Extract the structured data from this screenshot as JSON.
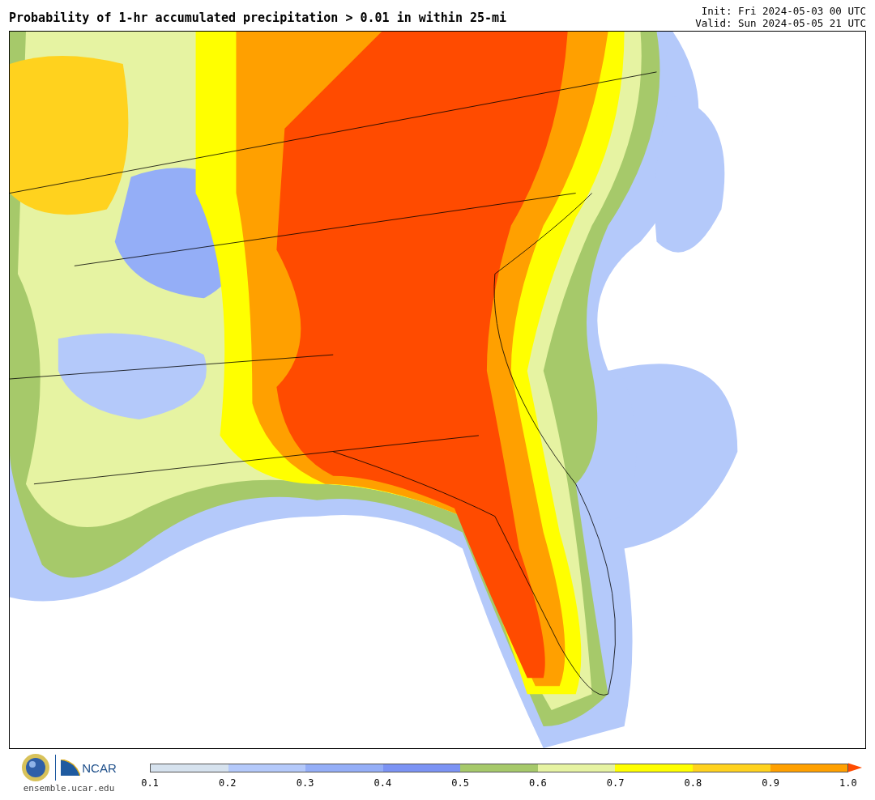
{
  "title": "Probability of 1-hr accumulated precipitation > 0.01 in within 25-mi",
  "init": "Init: Fri 2024-05-03 00 UTC",
  "valid": "Valid: Sun 2024-05-05 21 UTC",
  "footer": {
    "site": "ensemble.ucar.edu",
    "logo_text": "NCAR"
  },
  "colorbar": {
    "segments": [
      {
        "color": "#d6e2ee"
      },
      {
        "color": "#b4c9fa"
      },
      {
        "color": "#94aef7"
      },
      {
        "color": "#7b93f4"
      },
      {
        "color": "#a6c96a"
      },
      {
        "color": "#e6f3a2"
      },
      {
        "color": "#ffff00"
      },
      {
        "color": "#ffd21e"
      },
      {
        "color": "#ffa000"
      }
    ],
    "extend": {
      "color": "#ff4b00"
    },
    "ticks": [
      "0.1",
      "0.2",
      "0.3",
      "0.4",
      "0.5",
      "0.6",
      "0.7",
      "0.8",
      "0.9",
      "1.0"
    ]
  }
}
